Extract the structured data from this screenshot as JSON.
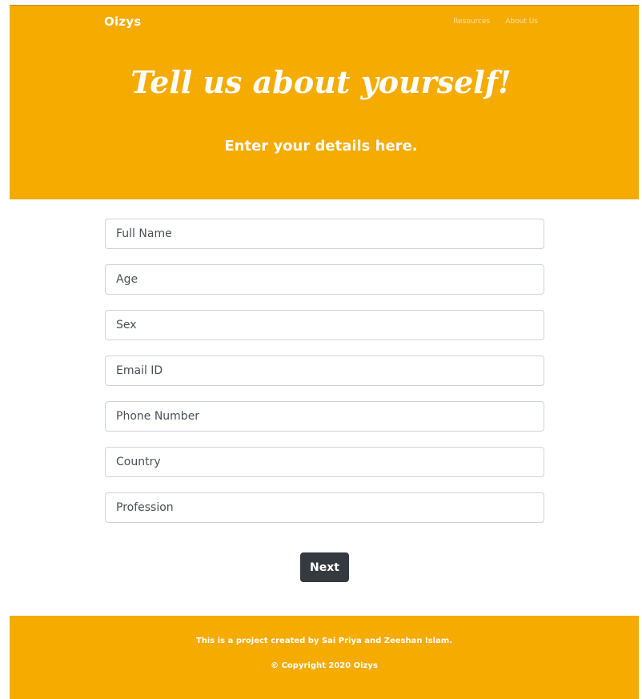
{
  "header": {
    "brand": "Oizys",
    "nav": {
      "resources": "Resources",
      "about": "About Us"
    }
  },
  "hero": {
    "title": "Tell us about yourself!",
    "subtitle": "Enter your details here."
  },
  "form": {
    "full_name": "Full Name",
    "age": "Age",
    "sex": "Sex",
    "email": "Email ID",
    "phone": "Phone Number",
    "country": "Country",
    "profession": "Profession"
  },
  "actions": {
    "next": "Next"
  },
  "footer": {
    "credit": "This is a project created by Sai Priya and Zeeshan Islam.",
    "copyright": "© Copyright 2020 Oizys"
  },
  "colors": {
    "accent": "#f5ab00",
    "button": "#343a40",
    "text_on_accent": "#ffffff"
  }
}
